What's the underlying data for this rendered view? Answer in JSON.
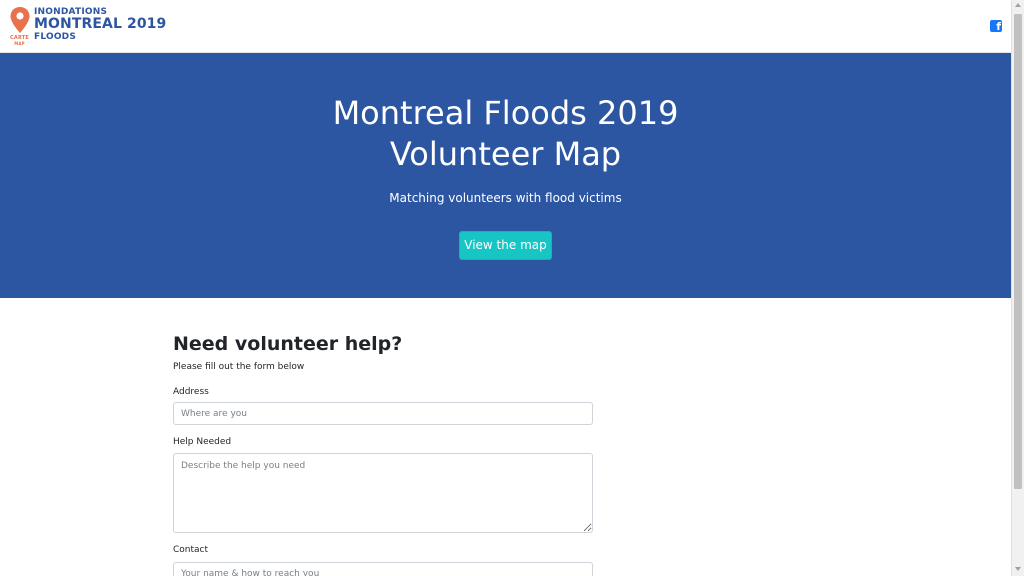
{
  "navbar": {
    "logo": {
      "line1": "INONDATIONS",
      "line2": "MONTREAL 2019",
      "line3": "FLOODS",
      "pin_label": "CARTE",
      "pin_sublabel": "MAP",
      "pin_color": "#e8724c",
      "text_color": "#2d55a2"
    },
    "social": {
      "icon": "facebook-icon",
      "glyph": "f",
      "color": "#1877f2"
    }
  },
  "hero": {
    "title_line1": "Montreal Floods 2019",
    "title_line2": "Volunteer Map",
    "subtitle": "Matching volunteers with flood victims",
    "button_label": "View the map",
    "background": "#2c55a2",
    "button_color": "#18c5c5"
  },
  "form": {
    "title": "Need volunteer help?",
    "description": "Please fill out the form below",
    "address": {
      "label": "Address",
      "placeholder": "Where are you"
    },
    "help": {
      "label": "Help Needed",
      "placeholder": "Describe the help you need"
    },
    "contact": {
      "label": "Contact",
      "placeholder": "Your name & how to reach you"
    }
  }
}
